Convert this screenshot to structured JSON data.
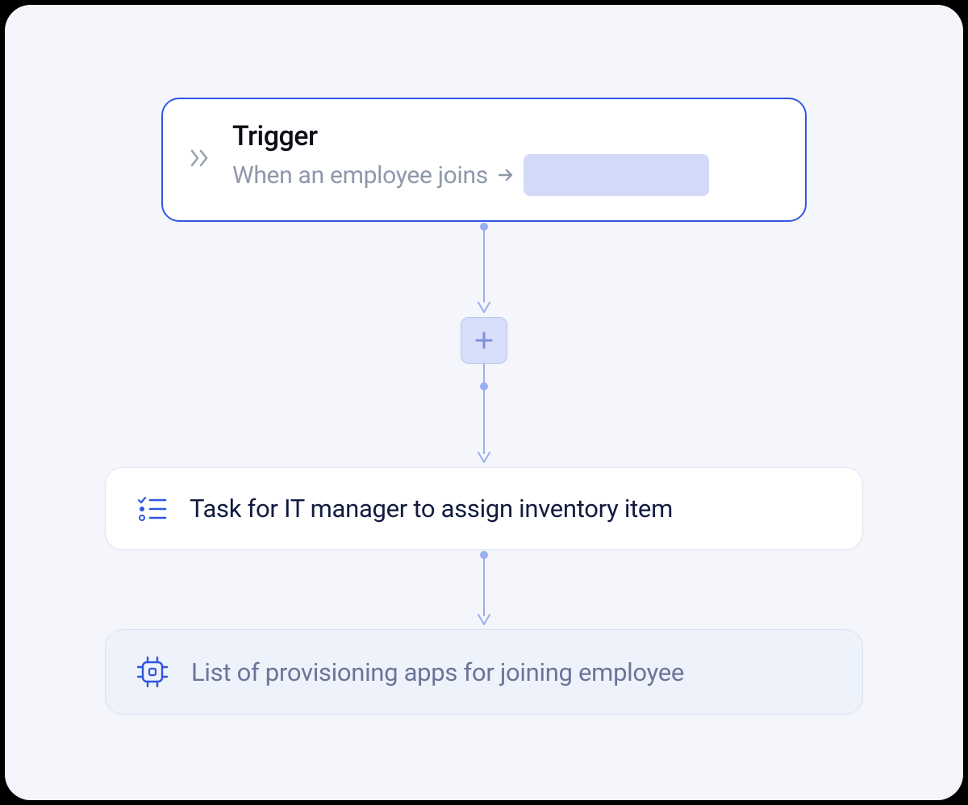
{
  "trigger": {
    "title": "Trigger",
    "subtitle": "When an employee joins"
  },
  "steps": {
    "task": "Task for IT manager to assign inventory item",
    "provisioning": "List of provisioning apps for joining employee"
  },
  "colors": {
    "accent": "#3057e1",
    "connector": "#99aef0"
  }
}
